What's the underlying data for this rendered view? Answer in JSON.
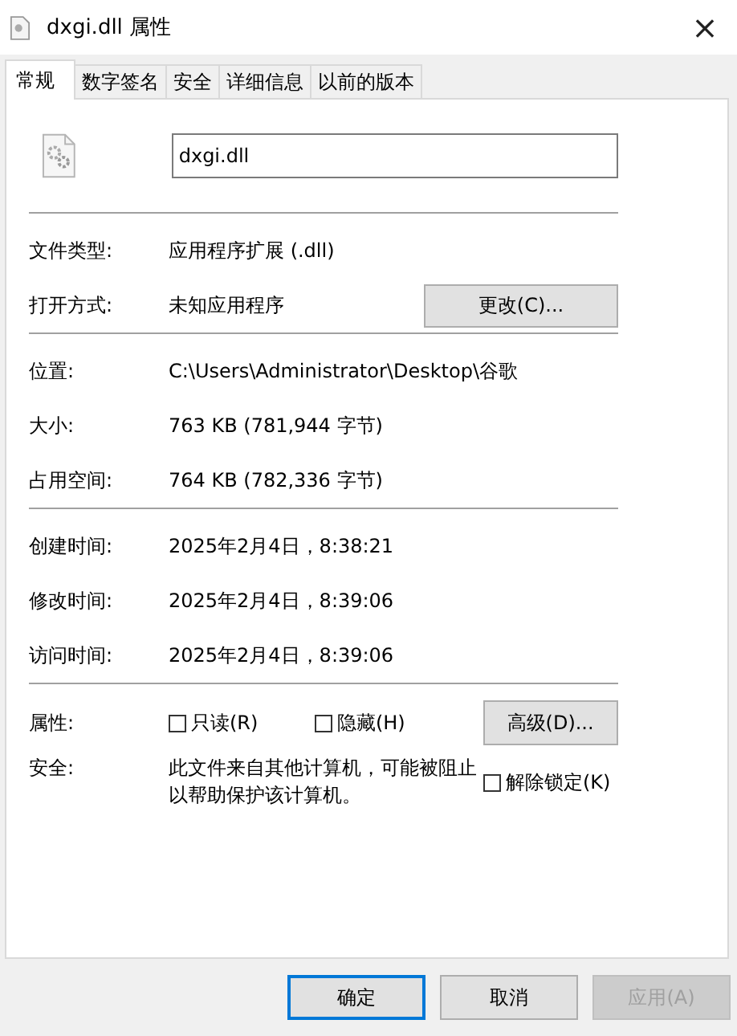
{
  "window": {
    "title": "dxgi.dll 属性",
    "close": "×"
  },
  "tabs": [
    {
      "label": "常规",
      "selected": true
    },
    {
      "label": "数字签名",
      "selected": false
    },
    {
      "label": "安全",
      "selected": false
    },
    {
      "label": "详细信息",
      "selected": false
    },
    {
      "label": "以前的版本",
      "selected": false
    }
  ],
  "file_name": "dxgi.dll",
  "type_section": {
    "file_type_label": "文件类型:",
    "file_type": "应用程序扩展 (.dll)",
    "opens_with_label": "打开方式:",
    "opens_with": "未知应用程序",
    "change_button": "更改(C)..."
  },
  "location_section": [
    {
      "label": "位置:",
      "value": "C:\\Users\\Administrator\\Desktop\\谷歌"
    },
    {
      "label": "大小:",
      "value": "763 KB (781,944 字节)"
    },
    {
      "label": "占用空间:",
      "value": "764 KB (782,336 字节)"
    }
  ],
  "time_section": [
    {
      "label": "创建时间:",
      "value": "2025年2月4日，8:38:21"
    },
    {
      "label": "修改时间:",
      "value": "2025年2月4日，8:39:06"
    },
    {
      "label": "访问时间:",
      "value": "2025年2月4日，8:39:06"
    }
  ],
  "attributes": {
    "label": "属性:",
    "read_only": {
      "label": "只读(R)",
      "checked": false
    },
    "hidden": {
      "label": "隐藏(H)",
      "checked": false
    },
    "advanced_button": "高级(D)..."
  },
  "security": {
    "label": "安全:",
    "text": "此文件来自其他计算机，可能被阻止以帮助保护该计算机。",
    "unblock": {
      "label": "解除锁定(K)",
      "checked": false
    }
  },
  "buttons": [
    {
      "label": "确定",
      "default": true,
      "disabled": false
    },
    {
      "label": "取消",
      "default": false,
      "disabled": false
    },
    {
      "label": "应用(A)",
      "default": false,
      "disabled": true
    }
  ]
}
